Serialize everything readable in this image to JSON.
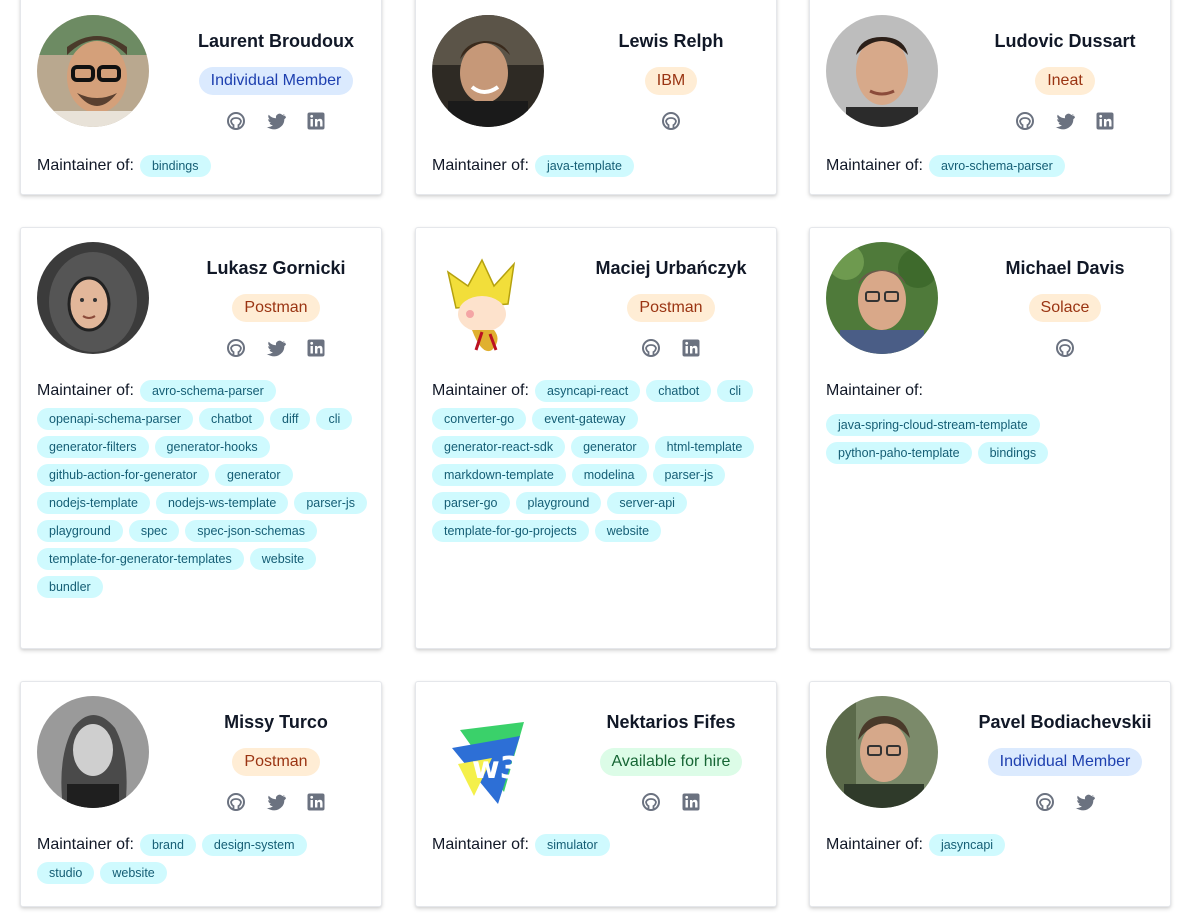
{
  "people": [
    {
      "name": "Laurent Broudoux",
      "badge": "Individual Member",
      "socials": [
        "github-icon",
        "twitter-icon",
        "linkedin-icon"
      ],
      "label": "Maintainer of:",
      "repos": [
        "bindings"
      ]
    },
    {
      "name": "Lewis Relph",
      "badge": "IBM",
      "socials": [
        "github-icon"
      ],
      "label": "Maintainer of:",
      "repos": [
        "java-template"
      ]
    },
    {
      "name": "Ludovic Dussart",
      "badge": "Ineat",
      "socials": [
        "github-icon",
        "twitter-icon",
        "linkedin-icon"
      ],
      "label": "Maintainer of:",
      "repos": [
        "avro-schema-parser"
      ]
    },
    {
      "name": "Lukasz Gornicki",
      "badge": "Postman",
      "socials": [
        "github-icon",
        "twitter-icon",
        "linkedin-icon"
      ],
      "label": "Maintainer of:",
      "repos": [
        "avro-schema-parser",
        "openapi-schema-parser",
        "chatbot",
        "diff",
        "cli",
        "generator-filters",
        "generator-hooks",
        "github-action-for-generator",
        "generator",
        "nodejs-template",
        "nodejs-ws-template",
        "parser-js",
        "playground",
        "spec",
        "spec-json-schemas",
        "template-for-generator-templates",
        "website",
        "bundler"
      ]
    },
    {
      "name": "Maciej Urbańczyk",
      "badge": "Postman",
      "socials": [
        "github-icon",
        "linkedin-icon"
      ],
      "label": "Maintainer of:",
      "repos": [
        "asyncapi-react",
        "chatbot",
        "cli",
        "converter-go",
        "event-gateway",
        "generator-react-sdk",
        "generator",
        "html-template",
        "markdown-template",
        "modelina",
        "parser-js",
        "parser-go",
        "playground",
        "server-api",
        "template-for-go-projects",
        "website"
      ]
    },
    {
      "name": "Michael Davis",
      "badge": "Solace",
      "socials": [
        "github-icon"
      ],
      "label": "Maintainer of:",
      "repos": [
        "java-spring-cloud-stream-template",
        "python-paho-template",
        "bindings"
      ]
    },
    {
      "name": "Missy Turco",
      "badge": "Postman",
      "socials": [
        "github-icon",
        "twitter-icon",
        "linkedin-icon"
      ],
      "label": "Maintainer of:",
      "repos": [
        "brand",
        "design-system",
        "studio",
        "website"
      ]
    },
    {
      "name": "Nektarios Fifes",
      "badge": "Available for hire",
      "socials": [
        "github-icon",
        "linkedin-icon"
      ],
      "label": "Maintainer of:",
      "repos": [
        "simulator"
      ]
    },
    {
      "name": "Pavel Bodiachevskii",
      "badge": "Individual Member",
      "socials": [
        "github-icon",
        "twitter-icon"
      ],
      "label": "Maintainer of:",
      "repos": [
        "jasyncapi"
      ]
    }
  ],
  "colors": {
    "badge_blue_bg": "#dbeafe",
    "badge_orange_bg": "#ffedd5",
    "badge_green_bg": "#dcfce7",
    "chip_bg": "#cffafe",
    "icon_gray": "#6b7280"
  }
}
